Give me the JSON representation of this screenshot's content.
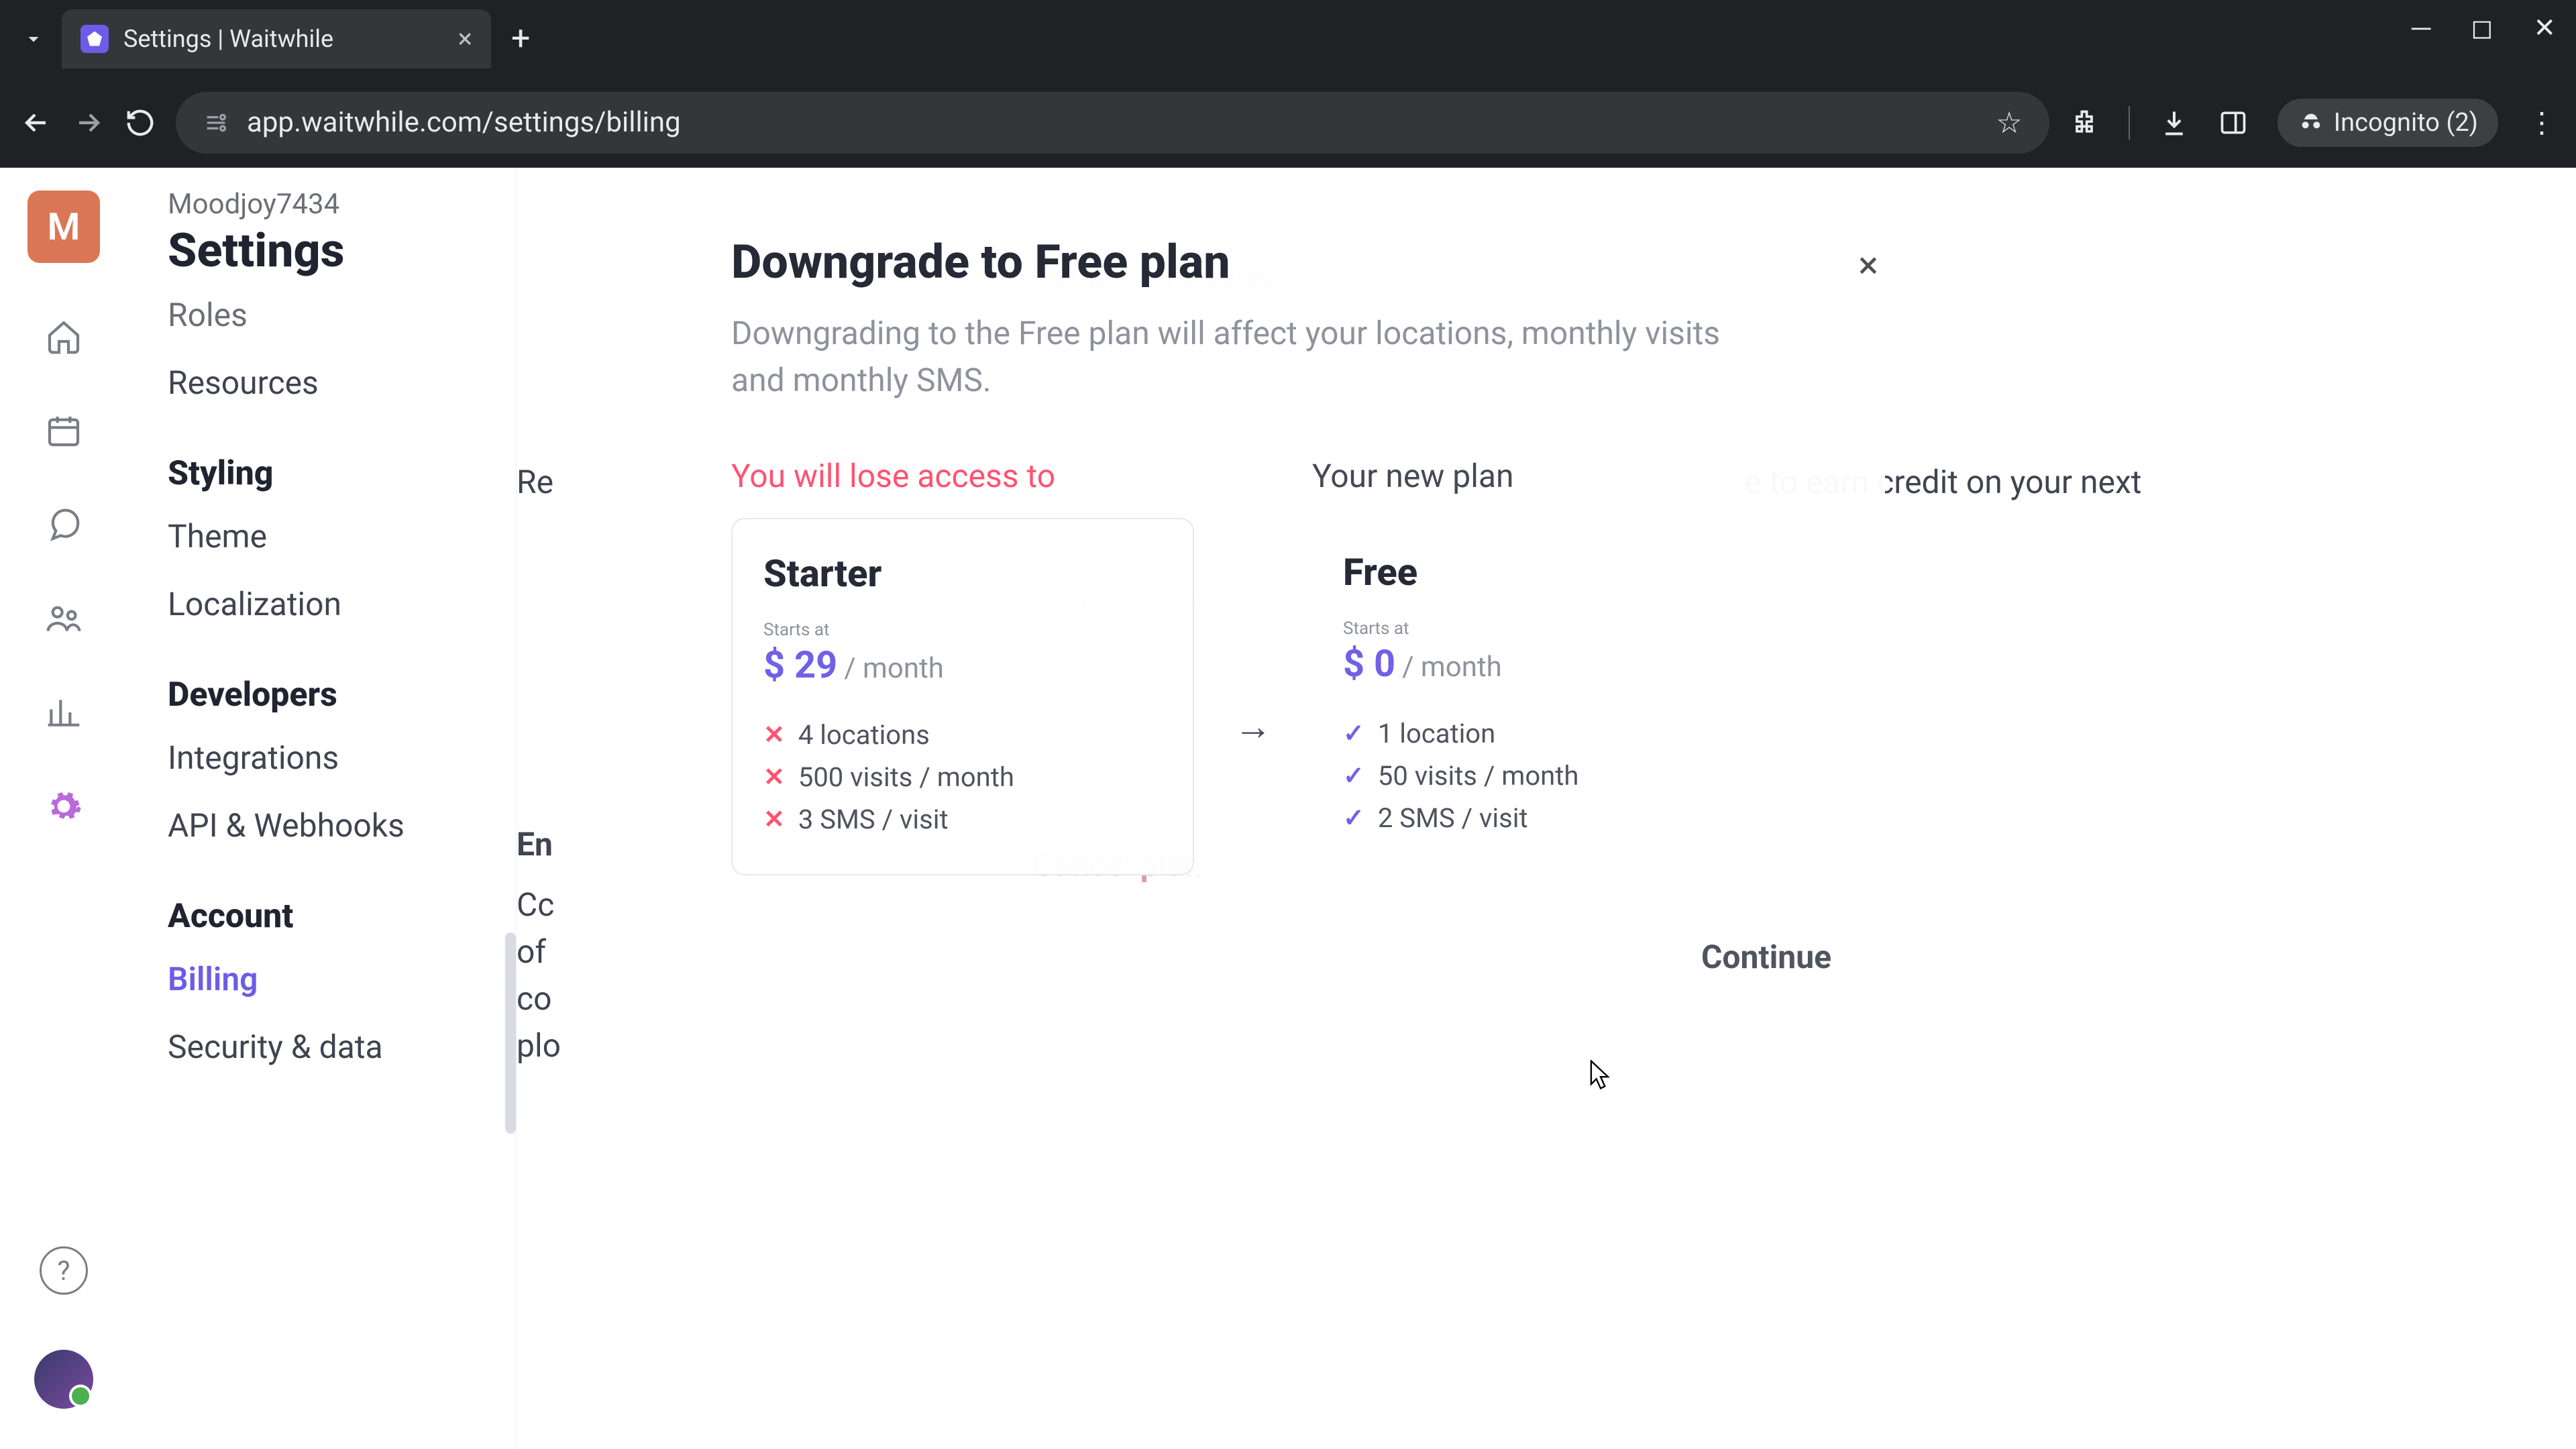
{
  "browser": {
    "tab_title": "Settings | Waitwhile",
    "url": "app.waitwhile.com/settings/billing",
    "incognito_label": "Incognito (2)"
  },
  "header": {
    "org_initial": "M",
    "org_name": "Moodjoy7434",
    "page_title": "Settings"
  },
  "sidebar": {
    "cut_item": "Roles",
    "item_resources": "Resources",
    "group_styling": "Styling",
    "item_theme": "Theme",
    "item_localization": "Localization",
    "group_developers": "Developers",
    "item_integrations": "Integrations",
    "item_api": "API & Webhooks",
    "group_account": "Account",
    "item_billing": "Billing",
    "item_security": "Security & data"
  },
  "background": {
    "frag_re": "Re",
    "frag_re_tail": "e to earn credit on your next",
    "frag_en": "En",
    "frag_cc": "Cc",
    "frag_of": "of",
    "frag_co": "co",
    "frag_pl": "plo",
    "frag_set_billing": "Set billing address",
    "frag_earn": "Earn $50 billing",
    "frag_cancel": "Cancel plan"
  },
  "modal": {
    "title": "Downgrade to Free plan",
    "subtitle": "Downgrading to the Free plan will affect your locations, monthly visits and monthly SMS.",
    "lose_heading": "You will lose access to",
    "new_heading": "Your new plan",
    "arrow": "→",
    "continue": "Continue",
    "starter": {
      "name": "Starter",
      "starts_at": "Starts at",
      "price": "$ 29",
      "per": "/ month",
      "f1": "4 locations",
      "f2": "500 visits / month",
      "f3": "3 SMS / visit"
    },
    "free": {
      "name": "Free",
      "starts_at": "Starts at",
      "price": "$ 0",
      "per": "/ month",
      "f1": "1 location",
      "f2": "50 visits / month",
      "f3": "2 SMS / visit"
    }
  }
}
